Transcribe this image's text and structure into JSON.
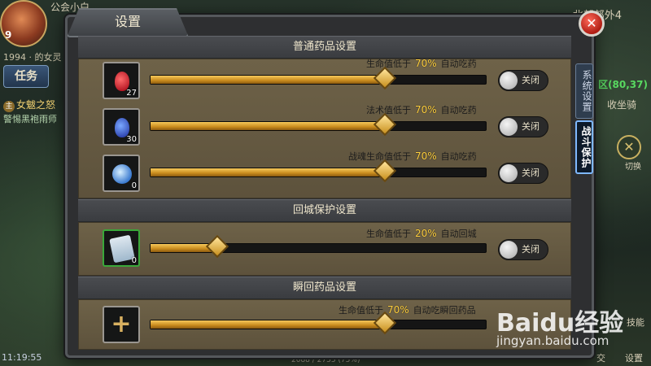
{
  "hud": {
    "level": "9",
    "top_text": "公会小白",
    "player_line": "1994 · 的女灵",
    "task_button": "任务",
    "quest_tag": "主",
    "quest_title": "女魃之怒",
    "quest_desc": "警惕黑袍雨师",
    "time": "11:19:55",
    "exp": "2088 / 2755 (75%)",
    "map_name": "北部郊外4",
    "coord": "区(80,37)",
    "ride": "收坐骑",
    "switch_label": "切换",
    "skill_label": "技能",
    "social_label": "交",
    "settings_label": "设置"
  },
  "dialog": {
    "title": "设置",
    "close_label": "✕",
    "side_tabs": [
      {
        "label": "系统设置",
        "active": false
      },
      {
        "label": "战斗保护",
        "active": true
      }
    ],
    "sections": [
      {
        "header": "普通药品设置",
        "rows": [
          {
            "icon": "red-potion-icon",
            "qty": "27",
            "prefix": "生命值低于",
            "percent": "70%",
            "suffix": "自动吃药",
            "level": 0.7,
            "toggle": "关闭"
          },
          {
            "icon": "blue-potion-icon",
            "qty": "30",
            "prefix": "法术值低于",
            "percent": "70%",
            "suffix": "自动吃药",
            "level": 0.7,
            "toggle": "关闭"
          },
          {
            "icon": "soul-orb-icon",
            "qty": "0",
            "prefix": "战魂生命值低于",
            "percent": "70%",
            "suffix": "自动吃药",
            "level": 0.7,
            "toggle": "关闭"
          }
        ]
      },
      {
        "header": "回城保护设置",
        "rows": [
          {
            "icon": "scroll-icon",
            "qty": "0",
            "prefix": "生命值低于",
            "percent": "20%",
            "suffix": "自动回城",
            "level": 0.2,
            "toggle": "关闭"
          }
        ]
      },
      {
        "header": "瞬回药品设置",
        "rows": [
          {
            "icon": "plus-icon",
            "qty": "",
            "prefix": "生命值低于",
            "percent": "70%",
            "suffix": "自动吃瞬回药品",
            "level": 0.7,
            "toggle": ""
          }
        ]
      }
    ]
  },
  "watermark": {
    "logo": "Baidu经验",
    "url": "jingyan.baidu.com"
  }
}
